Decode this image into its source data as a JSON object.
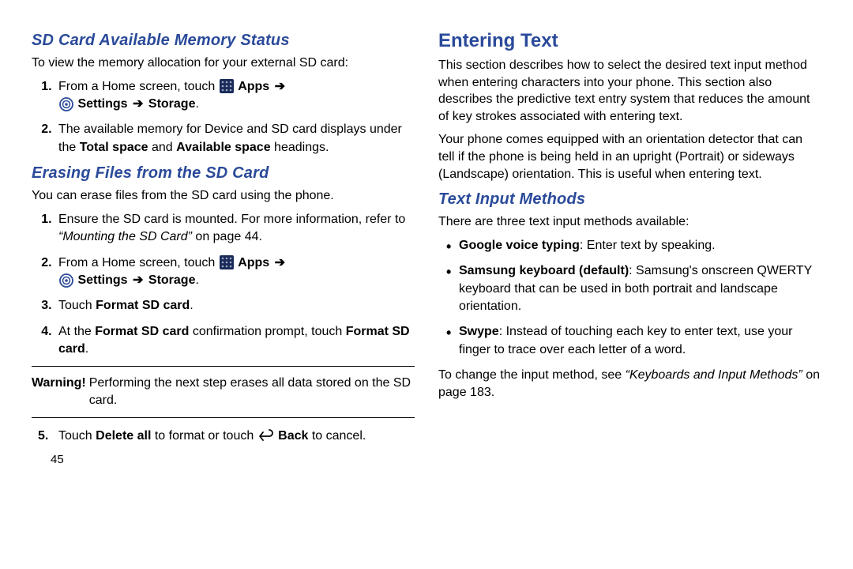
{
  "left": {
    "h1": "SD Card Available Memory Status",
    "p1": "To view the memory allocation for your external SD card:",
    "step1_a": "From a Home screen, touch ",
    "step1_apps": "Apps",
    "step1_settings": "Settings",
    "step1_storage": "Storage",
    "step2_a": "The available memory for Device and SD card displays under the ",
    "step2_total": "Total space",
    "step2_and": " and ",
    "step2_avail": "Available space",
    "step2_end": " headings.",
    "h2": "Erasing Files from the SD Card",
    "p2": "You can erase files from the SD card using the phone.",
    "e_step1_a": "Ensure the SD card is mounted. For more information, refer to ",
    "e_step1_ref": "“Mounting the SD Card”",
    "e_step1_end": " on page 44.",
    "e_step2_a": "From a Home screen, touch ",
    "e_step2_apps": "Apps",
    "e_step2_settings": "Settings",
    "e_step2_storage": "Storage",
    "e_step3_a": "Touch ",
    "e_step3_b": "Format SD card",
    "e_step3_end": ".",
    "e_step4_a": "At the ",
    "e_step4_b": "Format SD card",
    "e_step4_c": " confirmation prompt, touch ",
    "e_step4_d": "Format SD card",
    "e_step4_end": ".",
    "warn_label": "Warning!",
    "warn_text": " Performing the next step erases all data stored on the SD card.",
    "e_step5_a": "Touch ",
    "e_step5_b": "Delete all",
    "e_step5_c": " to format or touch ",
    "e_step5_back": "Back",
    "e_step5_end": " to cancel.",
    "page_num": "45"
  },
  "right": {
    "h1": "Entering Text",
    "p1": "This section describes how to select the desired text input method when entering characters into your phone. This section also describes the predictive text entry system that reduces the amount of key strokes associated with entering text.",
    "p2": "Your phone comes equipped with an orientation detector that can tell if the phone is being held in an upright (Portrait) or sideways (Landscape) orientation. This is useful when entering text.",
    "h2": "Text Input Methods",
    "p3": "There are three text input methods available:",
    "m1_b": "Google voice typing",
    "m1_t": ": Enter text by speaking.",
    "m2_b": "Samsung keyboard (default)",
    "m2_t": ": Samsung's onscreen QWERTY keyboard that can be used in both portrait and landscape orientation.",
    "m3_b": "Swype",
    "m3_t": ": Instead of touching each key to enter text, use your finger to trace over each letter of a word.",
    "p4_a": "To change the input method, see ",
    "p4_ref": "“Keyboards and Input Methods”",
    "p4_end": " on page 183."
  },
  "icons": {
    "apps": "apps-grid-icon",
    "settings": "settings-gear-icon",
    "back": "back-arrow-icon"
  }
}
